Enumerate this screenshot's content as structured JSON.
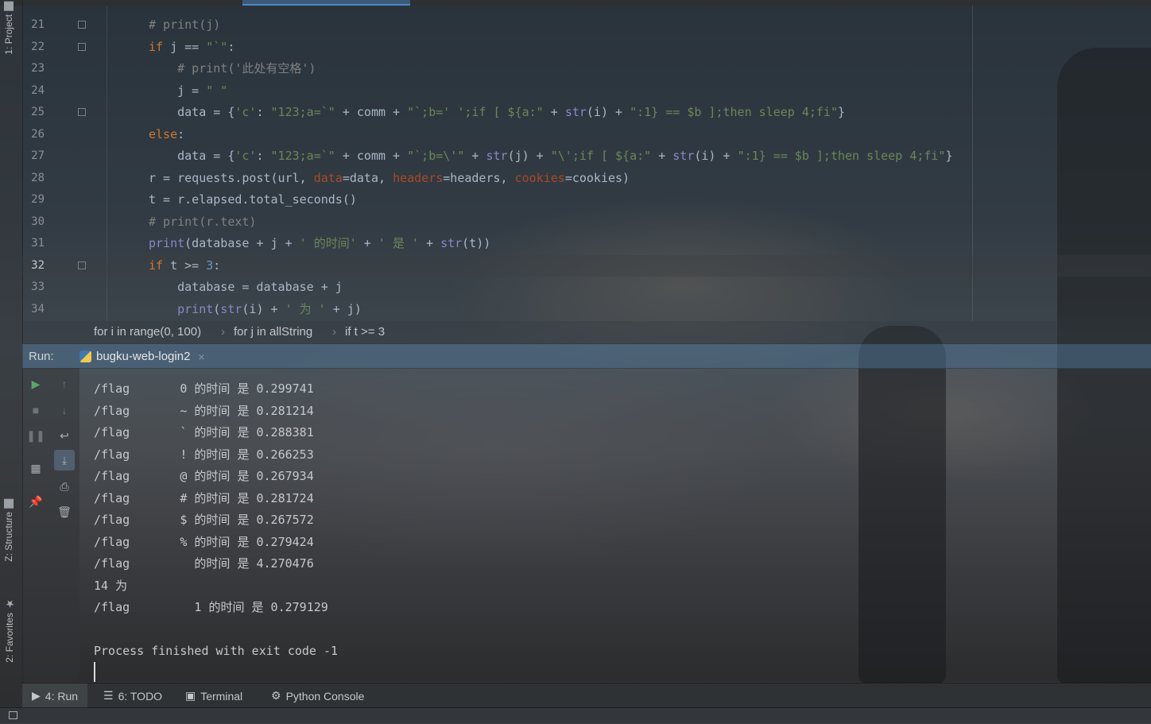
{
  "window": {
    "accent": "#4a88c7"
  },
  "left_tabs": {
    "project": "1: Project",
    "structure": "Z: Structure",
    "favorites": "2: Favorites"
  },
  "editor": {
    "lines": [
      {
        "n": "21",
        "fold": true
      },
      {
        "n": "22",
        "fold": true
      },
      {
        "n": "23"
      },
      {
        "n": "24"
      },
      {
        "n": "25",
        "fold": true
      },
      {
        "n": "26"
      },
      {
        "n": "27"
      },
      {
        "n": "28"
      },
      {
        "n": "29"
      },
      {
        "n": "30"
      },
      {
        "n": "31"
      },
      {
        "n": "32",
        "fold": true,
        "current": true
      },
      {
        "n": "33"
      },
      {
        "n": "34"
      }
    ]
  },
  "breadcrumb": {
    "items": [
      "for i in range(0, 100)",
      "for j in allString",
      "if t >= 3"
    ],
    "separator": "›"
  },
  "run": {
    "label": "Run:",
    "tab_title": "bugku-web-login2",
    "close": "×",
    "tools_left": [
      "run-icon",
      "stop-icon",
      "pause-icon",
      "layout-icon",
      "pin-icon"
    ],
    "tools_right": [
      "up-arrow-icon",
      "down-arrow-icon",
      "soft-wrap-icon",
      "scroll-to-end-icon",
      "print-icon",
      "trash-icon"
    ],
    "output": [
      "/flag       0 的时间 是 0.299741",
      "/flag       ~ 的时间 是 0.281214",
      "/flag       ` 的时间 是 0.288381",
      "/flag       ! 的时间 是 0.266253",
      "/flag       @ 的时间 是 0.267934",
      "/flag       # 的时间 是 0.281724",
      "/flag       $ 的时间 是 0.267572",
      "/flag       % 的时间 是 0.279424",
      "/flag         的时间 是 4.270476",
      "14 为",
      "/flag         1 的时间 是 0.279129",
      "",
      "Process finished with exit code -1"
    ]
  },
  "bottom_tabs": [
    {
      "label": "4: Run",
      "icon": "play-icon",
      "active": true
    },
    {
      "label": "6: TODO",
      "icon": "list-icon"
    },
    {
      "label": "Terminal",
      "icon": "terminal-icon"
    },
    {
      "label": "Python Console",
      "icon": "python-icon"
    }
  ],
  "colors": {
    "keyword": "#cc7832",
    "string": "#6a8759",
    "comment": "#808080",
    "number": "#6897bb",
    "builtin": "#8888c6"
  }
}
